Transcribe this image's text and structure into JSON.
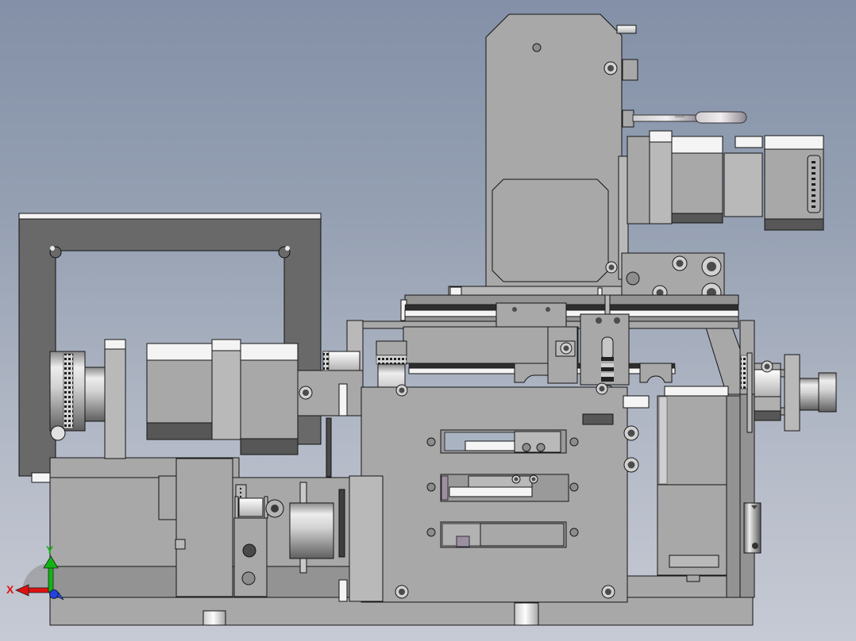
{
  "viewport": {
    "description": "Shaded CAD side view of a multi-axis automation machine assembly on gradient background",
    "background_top": "#8390a7",
    "background_bottom": "#c6cad4",
    "edge_color": "#151515",
    "part_gray_light": "#a8a8a8",
    "part_gray_dark_frame": "#696969",
    "part_band_dark": "#575757",
    "part_highlight": "#f4f4f4"
  },
  "triad": {
    "x_label": "X",
    "y_label": "Y",
    "x_color": "#e01111",
    "y_color": "#12b412",
    "z_color": "#2244dd",
    "arc_color": "#8a8a8a"
  },
  "parts": [
    "portal-frame",
    "left-base-plate",
    "bottom-base-plate",
    "left-motor-assembly",
    "left-pulley",
    "tower-column",
    "tower-access-panel",
    "clamp-handle",
    "x-axis-motor",
    "motor-connector",
    "motor-mount-bracket",
    "linear-rail",
    "rail-carriage",
    "center-slide-block",
    "fixture-plate",
    "fixture-slot-1",
    "fixture-slot-2",
    "fixture-slot-3",
    "right-motor-assembly",
    "output-shaft-coupling",
    "shaft-flange",
    "lower-belt-mechanism",
    "belt-pulley",
    "guide-cylinder",
    "orientation-triad"
  ]
}
